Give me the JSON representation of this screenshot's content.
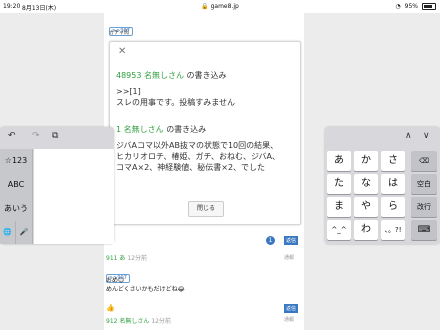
{
  "status": {
    "time": "19:20",
    "date": "8月13日(木)",
    "url": "game8.jp",
    "battery": "95%"
  },
  "top": {
    "ref": ">>907",
    "label": "ガチャ周"
  },
  "modal": {
    "post1": {
      "number": "48953",
      "name": "名無しさん",
      "suffix": "の書き込み",
      "lines": [
        ">>[1]",
        "スレの用事です。投稿すみません"
      ]
    },
    "post2": {
      "number": "1",
      "name": "名無しさん",
      "suffix": "の書き込み",
      "lines": [
        "ジバAコマ以外AB抜マの状態で10回の結果、",
        "ヒカリオロチ、椿姫、ガチ、おねむ、ジバA、",
        "コマA×2、神経験値、秘伝書×2、でした"
      ]
    },
    "close_label": "閉じる"
  },
  "below": {
    "count_badge": "1",
    "reply1": "返信",
    "post911_num": "911",
    "post911_name": "あ",
    "post911_time": "12分前",
    "report1": "通報",
    "ref2": ">>907",
    "text1": "おめ😊",
    "text2": "めんどくさいかもだけどね😂",
    "reply2": "返信",
    "post912_num": "912",
    "post912_name": "名無しさん",
    "post912_time": "12分前",
    "report2": "通報"
  },
  "keyboard_left": {
    "tools": [
      "↶",
      "↷",
      "⧉"
    ],
    "keys": [
      "☆123",
      "ABC",
      "あいう"
    ],
    "globe": "🌐",
    "mic": "🎤"
  },
  "keyboard_right": {
    "arrows": [
      "∧",
      "∨"
    ],
    "rows": [
      [
        "あ",
        "か",
        "さ"
      ],
      [
        "た",
        "な",
        "は"
      ],
      [
        "ま",
        "や",
        "ら"
      ],
      [
        "^_^",
        "わ",
        "、。?!"
      ]
    ],
    "func_keys": [
      "⌫",
      "空白",
      "改行",
      "⌨"
    ]
  },
  "colors": {
    "accent_green": "#2e9e3e",
    "link_blue": "#3a78c2"
  }
}
